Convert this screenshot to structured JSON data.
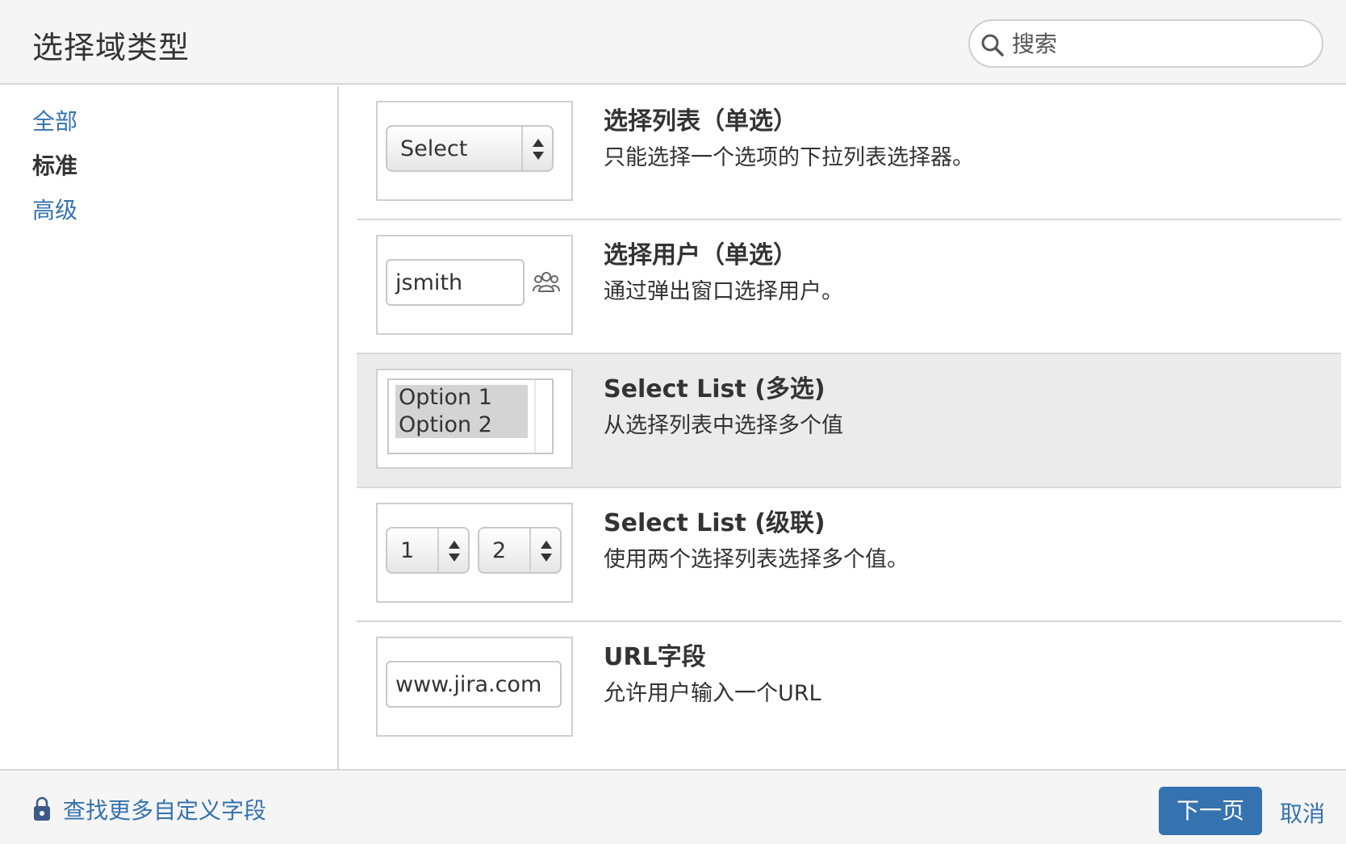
{
  "header": {
    "title": "选择域类型",
    "search_placeholder": "搜索",
    "search_icon": "search-icon"
  },
  "sidebar": {
    "items": [
      {
        "label": "全部",
        "active": false
      },
      {
        "label": "标准",
        "active": true
      },
      {
        "label": "高级",
        "active": false
      }
    ]
  },
  "field_types": [
    {
      "title": "选择列表（单选）",
      "description": "只能选择一个选项的下拉列表选择器。",
      "preview": {
        "select_label": "Select"
      }
    },
    {
      "title": "选择用户（单选）",
      "description": "通过弹出窗口选择用户。",
      "preview": {
        "value": "jsmith",
        "icon": "user-group-icon"
      }
    },
    {
      "title": "Select List (多选)",
      "description": "从选择列表中选择多个值",
      "selected": true,
      "preview": {
        "options": [
          "Option 1",
          "Option 2"
        ]
      }
    },
    {
      "title": "Select List (级联)",
      "description": "使用两个选择列表选择多个值。",
      "preview": {
        "first": "1",
        "second": "2"
      }
    },
    {
      "title": "URL字段",
      "description": "允许用户输入一个URL",
      "preview": {
        "value": "www.jira.com"
      }
    }
  ],
  "footer": {
    "more_fields_link": "查找更多自定义字段",
    "next_button": "下一页",
    "cancel": "取消"
  },
  "colors": {
    "link": "#3572b0",
    "primary_button": "#3572b0",
    "selected_row": "#ebebeb"
  }
}
